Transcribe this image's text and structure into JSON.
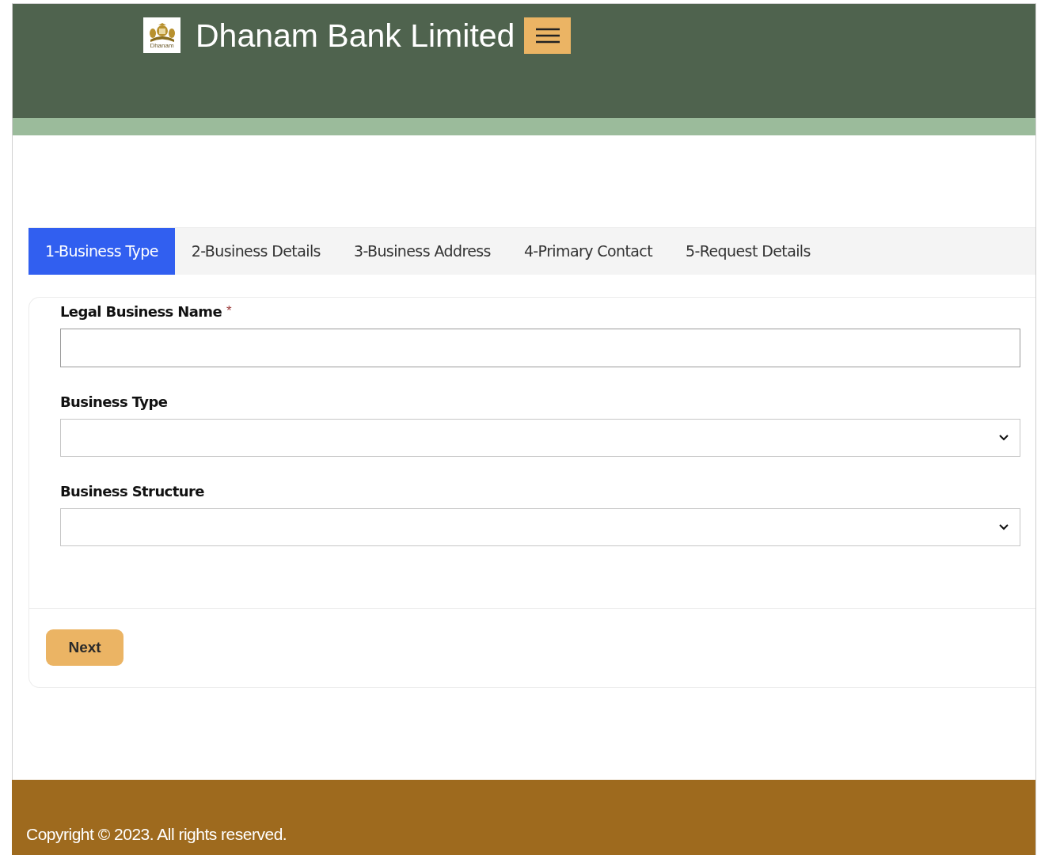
{
  "header": {
    "logo_text": "Dhanam",
    "title": "Dhanam Bank Limited"
  },
  "tabs": [
    {
      "label": "1-Business Type",
      "selected": true
    },
    {
      "label": "2-Business Details",
      "selected": false
    },
    {
      "label": "3-Business Address",
      "selected": false
    },
    {
      "label": "4-Primary Contact",
      "selected": false
    },
    {
      "label": "5-Request Details",
      "selected": false
    }
  ],
  "form": {
    "fields": [
      {
        "kind": "text",
        "label": "Legal Business Name",
        "required_mark": "*"
      },
      {
        "kind": "select",
        "label": "Business Type"
      },
      {
        "kind": "select",
        "label": "Business Structure"
      }
    ],
    "button": "Next"
  },
  "footer": {
    "text": "Copyright © 2023. All rights reserved."
  }
}
